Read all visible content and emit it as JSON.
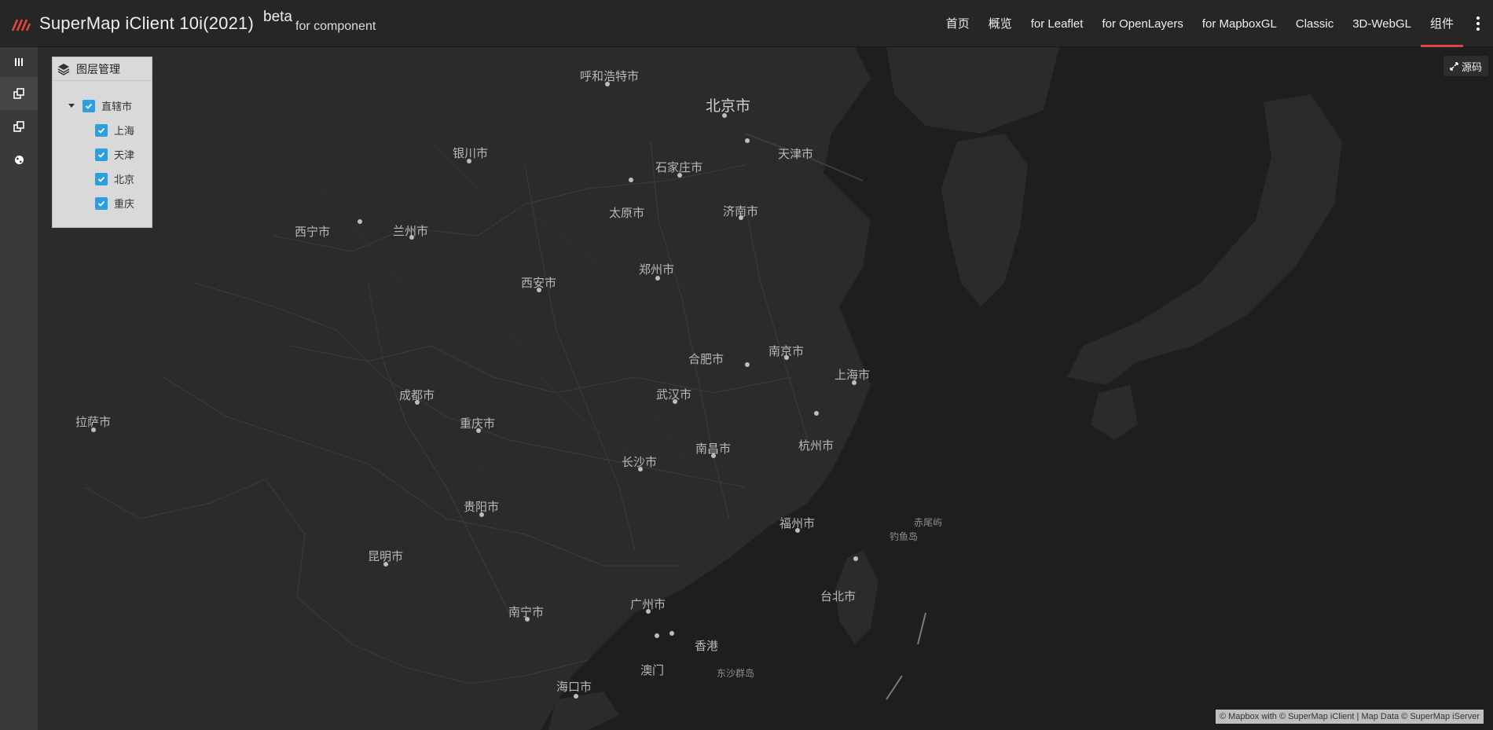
{
  "navbar": {
    "title": "SuperMap iClient 10i(2021)",
    "beta": "beta",
    "subtitle": "for component",
    "links": [
      {
        "label": "首页",
        "active": false
      },
      {
        "label": "概览",
        "active": false
      },
      {
        "label": "for Leaflet",
        "active": false
      },
      {
        "label": "for OpenLayers",
        "active": false
      },
      {
        "label": "for MapboxGL",
        "active": false
      },
      {
        "label": "Classic",
        "active": false
      },
      {
        "label": "3D-WebGL",
        "active": false
      },
      {
        "label": "组件",
        "active": true
      }
    ],
    "accent_color": "#e0463f"
  },
  "left_toolbar": {
    "tools": [
      {
        "icon": "layers-bars-icon"
      },
      {
        "icon": "layer-manage-icon"
      },
      {
        "icon": "layer-manage-icon"
      },
      {
        "icon": "globe-icon"
      }
    ]
  },
  "layer_panel": {
    "title": "图层管理",
    "group": {
      "label": "直辖市",
      "checked": true
    },
    "items": [
      {
        "label": "上海",
        "checked": true
      },
      {
        "label": "天津",
        "checked": true
      },
      {
        "label": "北京",
        "checked": true
      },
      {
        "label": "重庆",
        "checked": true
      }
    ],
    "checkbox_color": "#2c9fe0"
  },
  "source_button": {
    "label": "源码"
  },
  "attribution": "© Mapbox with © SuperMap iClient | Map Data © SuperMap iServer",
  "map": {
    "cities": [
      {
        "name": "呼和浩特市",
        "size": "normal"
      },
      {
        "name": "北京市",
        "size": "big"
      },
      {
        "name": "天津市",
        "size": "normal"
      },
      {
        "name": "银川市",
        "size": "normal"
      },
      {
        "name": "石家庄市",
        "size": "normal"
      },
      {
        "name": "太原市",
        "size": "normal"
      },
      {
        "name": "济南市",
        "size": "normal"
      },
      {
        "name": "西宁市",
        "size": "normal"
      },
      {
        "name": "兰州市",
        "size": "normal"
      },
      {
        "name": "郑州市",
        "size": "normal"
      },
      {
        "name": "西安市",
        "size": "normal"
      },
      {
        "name": "合肥市",
        "size": "normal"
      },
      {
        "name": "南京市",
        "size": "normal"
      },
      {
        "name": "上海市",
        "size": "normal"
      },
      {
        "name": "成都市",
        "size": "normal"
      },
      {
        "name": "武汉市",
        "size": "normal"
      },
      {
        "name": "拉萨市",
        "size": "normal"
      },
      {
        "name": "重庆市",
        "size": "normal"
      },
      {
        "name": "杭州市",
        "size": "normal"
      },
      {
        "name": "南昌市",
        "size": "normal"
      },
      {
        "name": "长沙市",
        "size": "normal"
      },
      {
        "name": "贵阳市",
        "size": "normal"
      },
      {
        "name": "福州市",
        "size": "normal"
      },
      {
        "name": "赤尾屿",
        "size": "small"
      },
      {
        "name": "钓鱼岛",
        "size": "small"
      },
      {
        "name": "昆明市",
        "size": "normal"
      },
      {
        "name": "台北市",
        "size": "normal"
      },
      {
        "name": "广州市",
        "size": "normal"
      },
      {
        "name": "南宁市",
        "size": "normal"
      },
      {
        "name": "香港",
        "size": "normal"
      },
      {
        "name": "澳门",
        "size": "normal"
      },
      {
        "name": "东沙群岛",
        "size": "small"
      },
      {
        "name": "海口市",
        "size": "normal"
      }
    ]
  }
}
